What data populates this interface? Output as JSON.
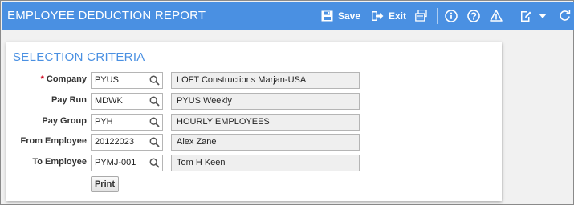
{
  "header": {
    "title": "EMPLOYEE DEDUCTION REPORT",
    "save_label": "Save",
    "exit_label": "Exit",
    "icons": [
      "save-icon",
      "exit-icon",
      "print-preview-icon",
      "info-icon",
      "help-icon",
      "warning-icon",
      "edit-icon",
      "dropdown-caret-icon",
      "refresh-icon"
    ]
  },
  "colors": {
    "header_bg": "#4a90e2",
    "section_title": "#4a90e2",
    "required_marker": "#d0021b"
  },
  "criteria": {
    "title": "SELECTION CRITERIA",
    "fields": [
      {
        "required": "*",
        "label": "Company",
        "code": "PYUS",
        "description": "LOFT Constructions Marjan-USA"
      },
      {
        "required": "",
        "label": "Pay Run",
        "code": "MDWK",
        "description": "PYUS Weekly"
      },
      {
        "required": "",
        "label": "Pay Group",
        "code": "PYH",
        "description": "HOURLY EMPLOYEES"
      },
      {
        "required": "",
        "label": "From Employee",
        "code": "20122023",
        "description": "Alex Zane"
      },
      {
        "required": "",
        "label": "To Employee",
        "code": "PYMJ-001",
        "description": "Tom H Keen"
      }
    ],
    "print_label": "Print"
  }
}
